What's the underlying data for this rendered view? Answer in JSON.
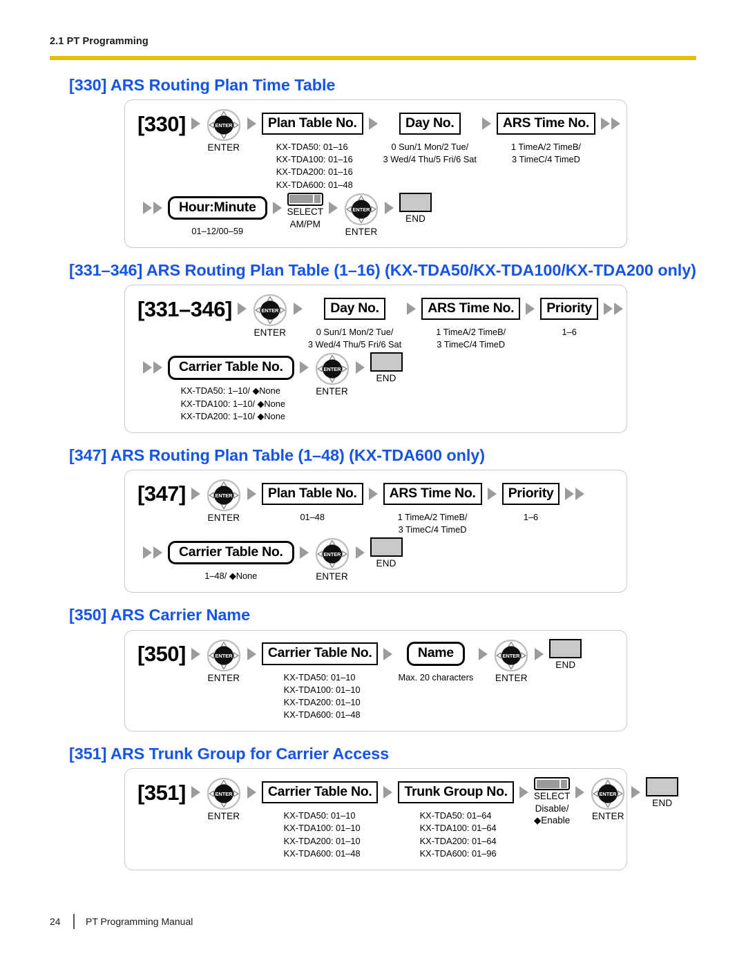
{
  "header": {
    "running_head": "2.1 PT Programming"
  },
  "footer": {
    "page_number": "24",
    "manual_title": "PT Programming Manual"
  },
  "colors": {
    "heading_blue": "#1554e8",
    "rule_gold": "#e3be09",
    "arrow_gray": "#9b9b9b",
    "end_fill": "#c9c9c9"
  },
  "icons": {
    "navigator_label": "ENTER",
    "select_label": "SELECT",
    "end_label": "END",
    "navigator_center_text": "ENTER"
  },
  "sections": [
    {
      "heading": "[330] ARS Routing Plan Time Table",
      "code": "[330]",
      "row1": [
        {
          "kind": "navigator",
          "label": "ENTER"
        },
        {
          "kind": "pbox",
          "label": "Plan Table No.",
          "caption": "KX-TDA50: 01–16\nKX-TDA100: 01–16\nKX-TDA200: 01–16\nKX-TDA600: 01–48"
        },
        {
          "kind": "pbox",
          "label": "Day No.",
          "caption": "0 Sun/1 Mon/2 Tue/\n3 Wed/4 Thu/5 Fri/6 Sat"
        },
        {
          "kind": "pbox",
          "label": "ARS Time No.",
          "caption": "1 TimeA/2 TimeB/\n3 TimeC/4 TimeD"
        }
      ],
      "row2": [
        {
          "kind": "rbox",
          "label": "Hour:Minute",
          "caption": "01–12/00–59"
        },
        {
          "kind": "select",
          "label": "SELECT",
          "caption": "AM/PM"
        },
        {
          "kind": "navigator",
          "label": "ENTER"
        },
        {
          "kind": "end",
          "label": "END"
        }
      ]
    },
    {
      "heading": "[331–346] ARS Routing Plan Table (1–16) (KX-TDA50/KX-TDA100/KX-TDA200 only)",
      "code": "[331–346]",
      "row1": [
        {
          "kind": "navigator",
          "label": "ENTER"
        },
        {
          "kind": "pbox",
          "label": "Day No.",
          "caption": "0 Sun/1 Mon/2 Tue/\n3 Wed/4 Thu/5 Fri/6 Sat"
        },
        {
          "kind": "pbox",
          "label": "ARS Time No.",
          "caption": "1 TimeA/2 TimeB/\n3 TimeC/4 TimeD"
        },
        {
          "kind": "pbox",
          "label": "Priority",
          "caption": "1–6"
        }
      ],
      "row2": [
        {
          "kind": "rbox",
          "label": "Carrier Table No.",
          "caption": "KX-TDA50: 1–10/ ◆None\nKX-TDA100: 1–10/ ◆None\nKX-TDA200: 1–10/ ◆None"
        },
        {
          "kind": "navigator",
          "label": "ENTER"
        },
        {
          "kind": "end",
          "label": "END"
        }
      ]
    },
    {
      "heading": "[347] ARS Routing Plan Table (1–48) (KX-TDA600 only)",
      "code": "[347]",
      "row1": [
        {
          "kind": "navigator",
          "label": "ENTER"
        },
        {
          "kind": "pbox",
          "label": "Plan Table No.",
          "caption": "01–48"
        },
        {
          "kind": "pbox",
          "label": "ARS Time No.",
          "caption": "1 TimeA/2 TimeB/\n3 TimeC/4 TimeD"
        },
        {
          "kind": "pbox",
          "label": "Priority",
          "caption": "1–6"
        }
      ],
      "row2": [
        {
          "kind": "rbox",
          "label": "Carrier Table No.",
          "caption": "1–48/ ◆None"
        },
        {
          "kind": "navigator",
          "label": "ENTER"
        },
        {
          "kind": "end",
          "label": "END"
        }
      ]
    },
    {
      "heading": "[350] ARS Carrier Name",
      "code": "[350]",
      "row1": [
        {
          "kind": "navigator",
          "label": "ENTER"
        },
        {
          "kind": "pbox",
          "label": "Carrier Table No.",
          "caption": "KX-TDA50: 01–10\nKX-TDA100: 01–10\nKX-TDA200: 01–10\nKX-TDA600: 01–48"
        },
        {
          "kind": "rbox",
          "label": "Name",
          "caption": "Max. 20 characters"
        },
        {
          "kind": "navigator",
          "label": "ENTER"
        },
        {
          "kind": "end",
          "label": "END"
        }
      ]
    },
    {
      "heading": "[351] ARS Trunk Group for Carrier Access",
      "code": "[351]",
      "row1": [
        {
          "kind": "navigator",
          "label": "ENTER"
        },
        {
          "kind": "pbox",
          "label": "Carrier Table No.",
          "caption": "KX-TDA50: 01–10\nKX-TDA100: 01–10\nKX-TDA200: 01–10\nKX-TDA600: 01–48"
        },
        {
          "kind": "pbox",
          "label": "Trunk Group No.",
          "caption": "KX-TDA50: 01–64\nKX-TDA100: 01–64\nKX-TDA200: 01–64\nKX-TDA600: 01–96"
        },
        {
          "kind": "select",
          "label": "SELECT",
          "caption": "Disable/\n◆Enable"
        },
        {
          "kind": "navigator",
          "label": "ENTER"
        },
        {
          "kind": "end",
          "label": "END"
        }
      ]
    }
  ]
}
